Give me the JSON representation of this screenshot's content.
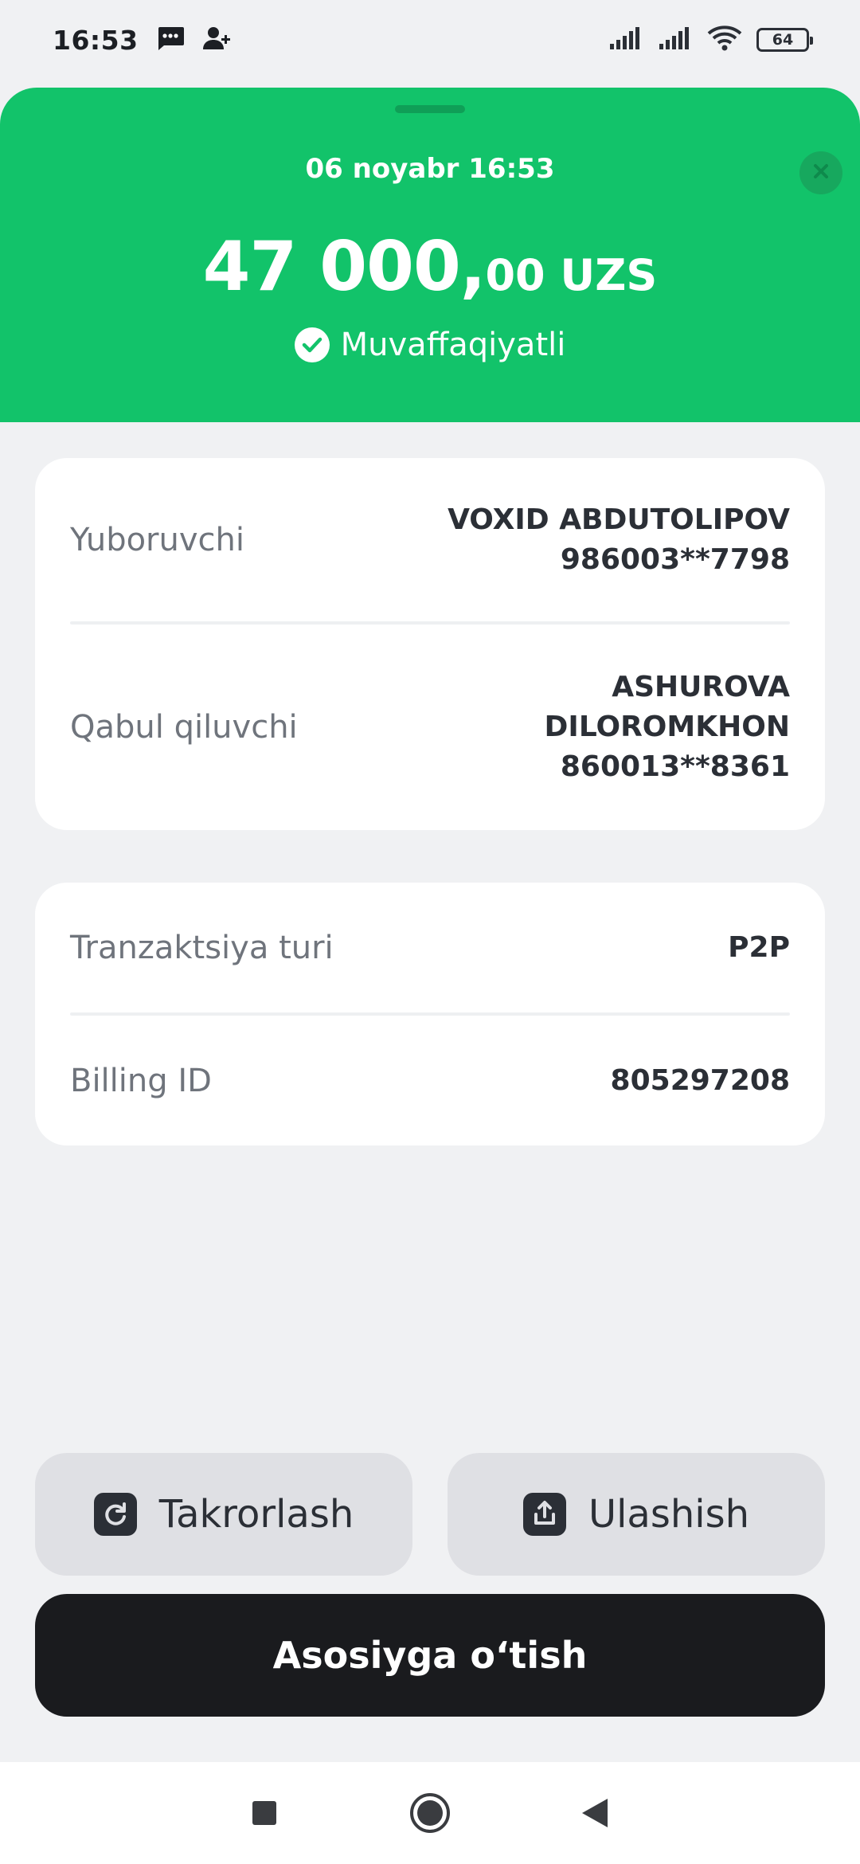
{
  "status_bar": {
    "time": "16:53",
    "battery": "64",
    "icons": [
      "message-icon",
      "contact-add-icon",
      "signal-icon",
      "signal-icon",
      "wifi-icon",
      "battery-icon"
    ]
  },
  "header": {
    "date": "06 noyabr 16:53",
    "amount_main": "47 000,",
    "amount_fraction": "00 UZS",
    "status": "Muvaffaqiyatli",
    "bg_color": "#12c36a"
  },
  "parties": {
    "sender_label": "Yuboruvchi",
    "sender_name": "VOXID ABDUTOLIPOV",
    "sender_card": "986003**7798",
    "receiver_label": "Qabul qiluvchi",
    "receiver_name_line1": "ASHUROVA",
    "receiver_name_line2": "DILOROMKHON",
    "receiver_card": "860013**8361"
  },
  "details": {
    "type_label": "Tranzaktsiya turi",
    "type_value": "P2P",
    "billing_label": "Billing ID",
    "billing_value": "805297208"
  },
  "actions": {
    "repeat_label": "Takrorlash",
    "share_label": "Ulashish",
    "home_label": "Asosiyga o‘tish"
  },
  "nav": {
    "items": [
      "recents-icon",
      "home-icon",
      "back-icon"
    ]
  }
}
